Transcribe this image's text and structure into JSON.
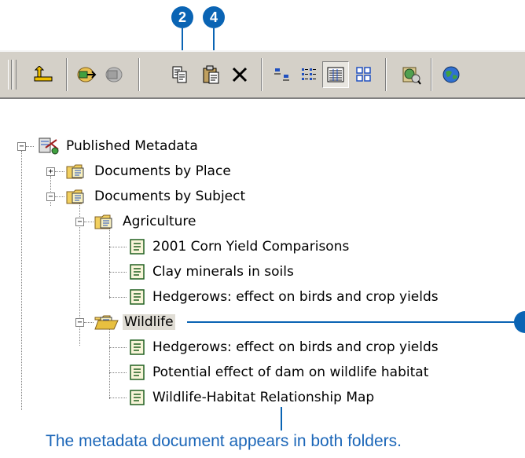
{
  "callouts": {
    "copy_step": "2",
    "paste_step": "4"
  },
  "toolbar": {
    "buttons": [
      {
        "name": "up-one-level-icon"
      },
      {
        "name": "connect-folder-icon"
      },
      {
        "name": "disconnect-folder-icon"
      },
      {
        "name": "copy-icon"
      },
      {
        "name": "paste-icon"
      },
      {
        "name": "delete-icon"
      },
      {
        "name": "large-icons-view-icon"
      },
      {
        "name": "list-view-icon"
      },
      {
        "name": "details-view-icon",
        "pressed": true
      },
      {
        "name": "thumbnails-view-icon"
      },
      {
        "name": "launch-arcmap-icon"
      },
      {
        "name": "globe-icon"
      }
    ]
  },
  "tree": {
    "root": "Published Metadata",
    "by_place": "Documents by Place",
    "by_subject": "Documents by Subject",
    "agriculture": "Agriculture",
    "agri_docs": [
      "2001 Corn Yield Comparisons",
      "Clay minerals in soils",
      "Hedgerows: effect on birds and crop yields"
    ],
    "wildlife": "Wildlife",
    "wildlife_docs": [
      "Hedgerows: effect on birds and crop yields",
      "Potential effect of dam on wildlife habitat",
      "Wildlife-Habitat Relationship Map"
    ]
  },
  "caption": "The metadata document appears in both folders.",
  "colors": {
    "callout": "#0a64b4",
    "caption_text": "#1b66b8",
    "toolbar_bg": "#d4d0c8"
  }
}
